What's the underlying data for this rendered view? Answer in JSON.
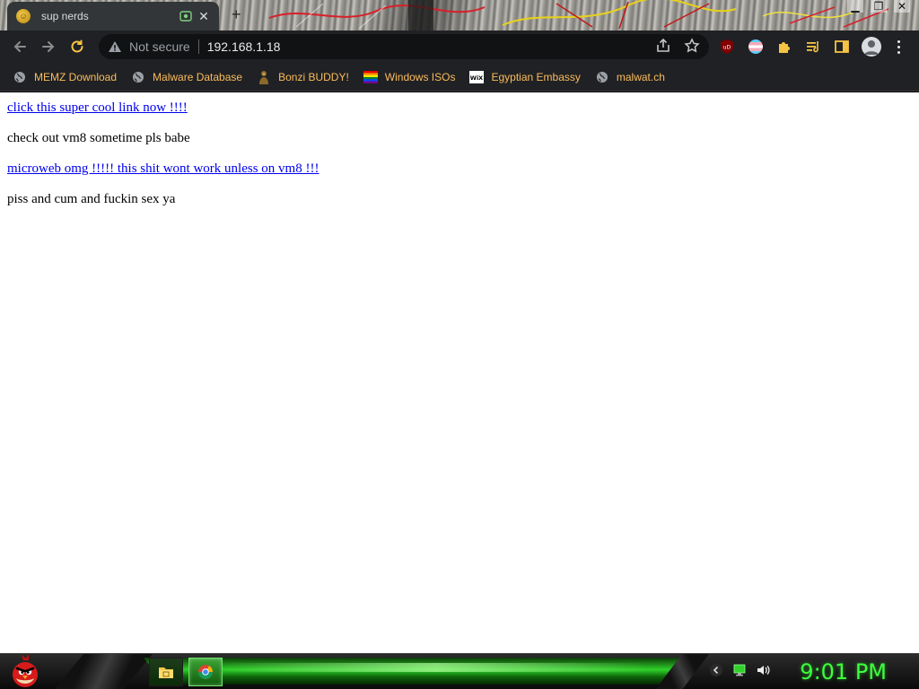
{
  "browser": {
    "tab": {
      "title": "sup nerds"
    },
    "omnibox": {
      "security_label": "Not secure",
      "url": "192.168.1.18"
    },
    "bookmarks": [
      {
        "label": "MEMZ Download",
        "icon": "globe-icon"
      },
      {
        "label": "Malware Database",
        "icon": "globe-icon"
      },
      {
        "label": "Bonzi BUDDY!",
        "icon": "bonzi-icon"
      },
      {
        "label": "Windows ISOs",
        "icon": "rainbow-flag-icon"
      },
      {
        "label": "Egyptian Embassy",
        "icon": "wix-icon"
      },
      {
        "label": "malwat.ch",
        "icon": "globe-icon"
      }
    ],
    "accent_colors": {
      "toolbar": "#202124",
      "bookmark_text": "#fbbc5d",
      "link": "#0000ee"
    }
  },
  "page": {
    "items": [
      {
        "type": "link",
        "text": "click this super cool link now !!!!"
      },
      {
        "type": "text",
        "text": "check out vm8 sometime pls babe"
      },
      {
        "type": "link",
        "text": "microweb omg !!!!! this shit wont work unless on vm8 !!!"
      },
      {
        "type": "text",
        "text": "piss and cum and fuckin sex ya"
      }
    ]
  },
  "taskbar": {
    "clock": "9:01 PM",
    "apps": [
      "file-explorer-icon",
      "chrome-icon"
    ],
    "tray_icons": [
      "chevron-icon",
      "network-icon",
      "volume-icon"
    ],
    "accent": "#3cff3c"
  }
}
